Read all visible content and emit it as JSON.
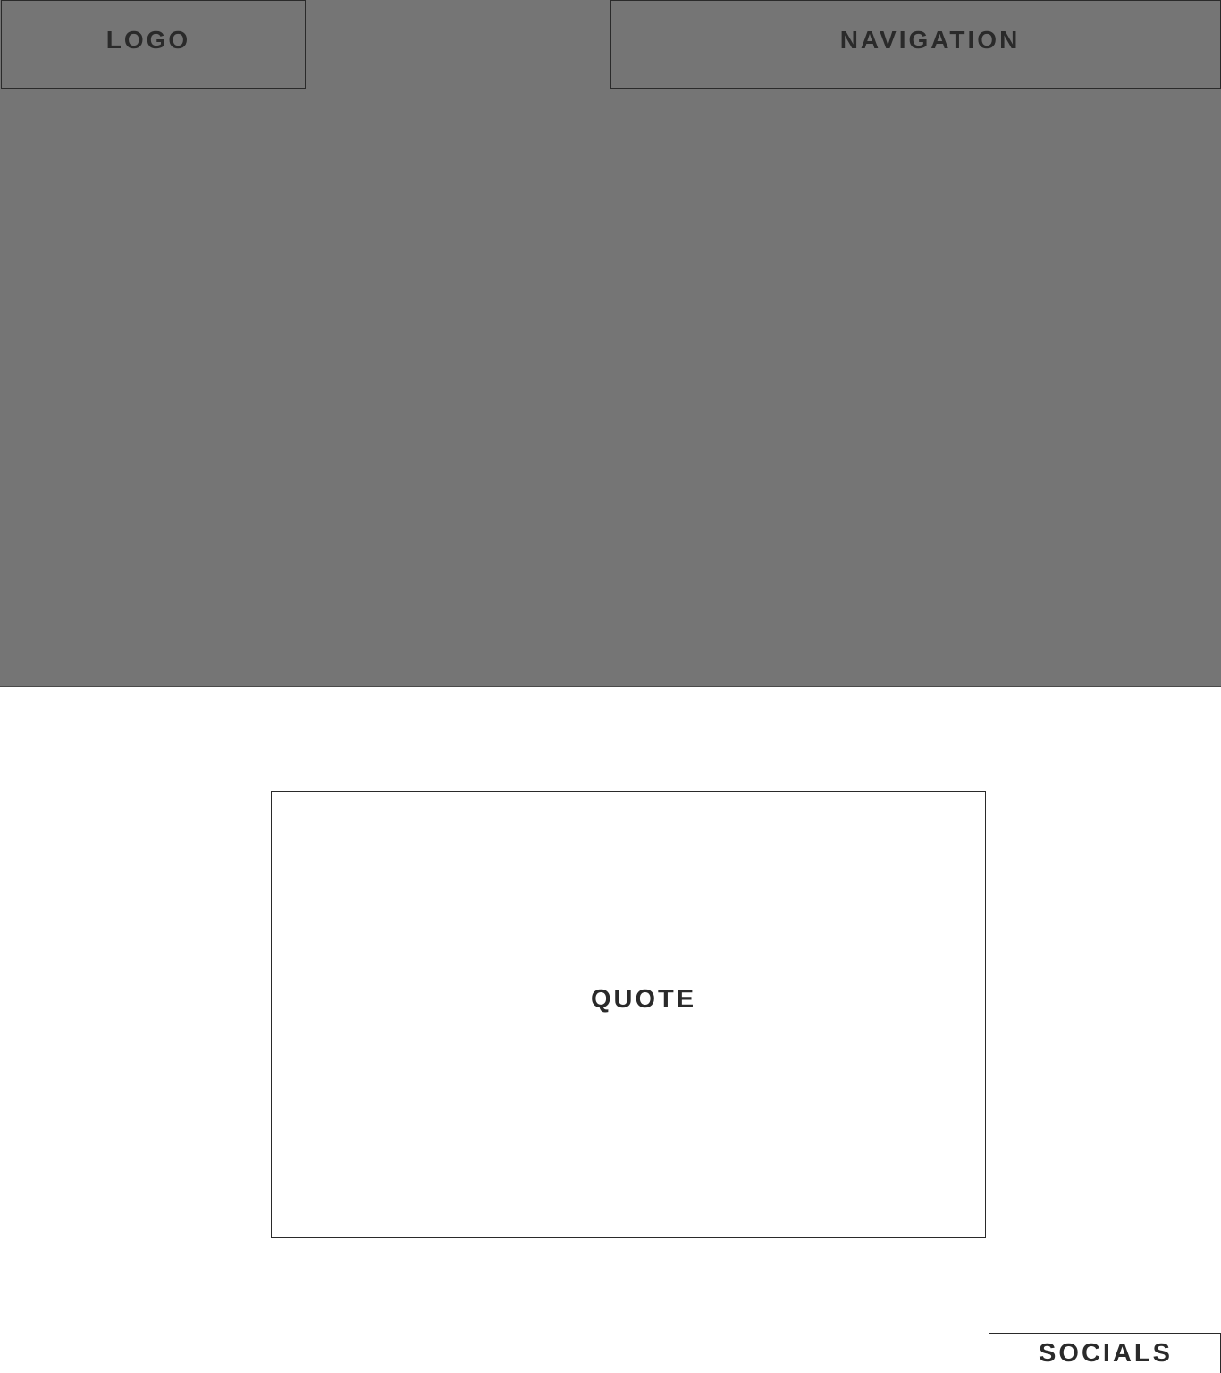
{
  "header": {
    "logo_label": "LOGO",
    "navigation_label": "NAVIGATION"
  },
  "main": {
    "quote_label": "QUOTE"
  },
  "footer": {
    "socials_label": "SOCIALS"
  },
  "colors": {
    "hero_background": "#757575",
    "page_background": "#ffffff",
    "text": "#2a2a2a",
    "border": "#2a2a2a"
  }
}
